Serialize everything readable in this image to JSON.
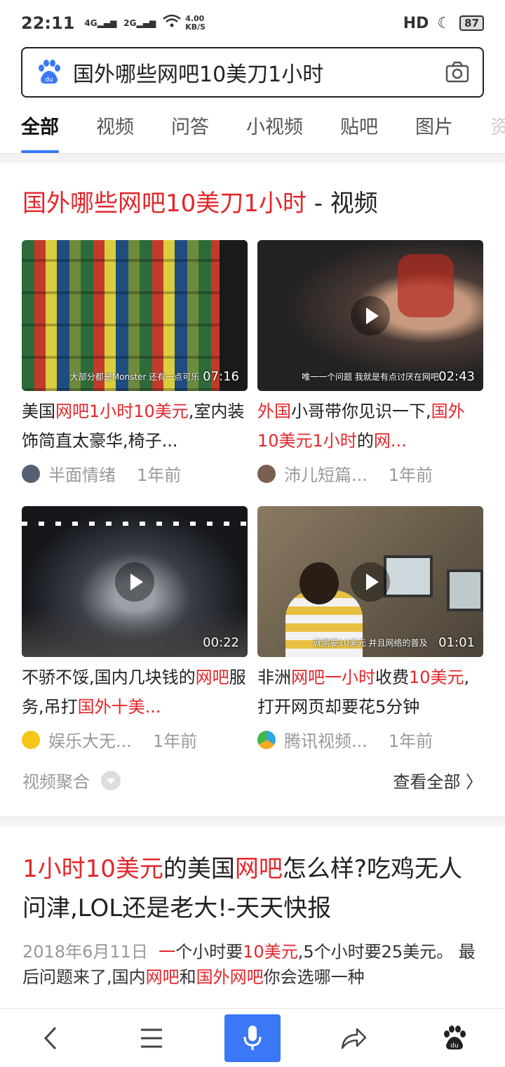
{
  "status_bar": {
    "time": "22:11",
    "signal_1": "4G",
    "signal_2": "2G",
    "speed_value": "4.00",
    "speed_unit": "KB/S",
    "hd": "HD",
    "battery": "87"
  },
  "search": {
    "query": "国外哪些网吧10美刀1小时"
  },
  "tabs": [
    "全部",
    "视频",
    "问答",
    "小视频",
    "贴吧",
    "图片",
    "资"
  ],
  "video_section": {
    "title_highlight": "国外哪些网吧10美刀1小时",
    "title_suffix": " - 视频",
    "cards": [
      {
        "duration": "07:16",
        "caption": "大部分都是Monster 还有一点可乐",
        "title_parts": [
          [
            "美国",
            false
          ],
          [
            "网吧1小时10美元",
            true
          ],
          [
            ",室内装饰简直太豪华,椅子...",
            false
          ]
        ],
        "author": "半面情绪",
        "time": "1年前"
      },
      {
        "duration": "02:43",
        "caption": "唯一一个问题 我就是有点讨厌在网吧",
        "title_parts": [
          [
            "外国",
            true
          ],
          [
            "小哥带你见识一下,",
            false
          ],
          [
            "国外10美元1小时",
            true
          ],
          [
            "的",
            false
          ],
          [
            "网...",
            true
          ]
        ],
        "author": "沛儿短篇...",
        "time": "1年前"
      },
      {
        "duration": "00:22",
        "caption": "",
        "title_parts": [
          [
            "不骄不馁,国内几块钱的",
            false
          ],
          [
            "网吧",
            true
          ],
          [
            "服务,吊打",
            false
          ],
          [
            "国外十美...",
            true
          ]
        ],
        "author": "娱乐大无...",
        "time": "1年前"
      },
      {
        "duration": "01:01",
        "caption": "就需要10美元 并且网络的普及",
        "title_parts": [
          [
            "非洲",
            false
          ],
          [
            "网吧一小时",
            true
          ],
          [
            "收费",
            false
          ],
          [
            "10美元",
            true
          ],
          [
            ",打开网页却要花5分钟",
            false
          ]
        ],
        "author": "腾讯视频...",
        "time": "1年前"
      }
    ],
    "aggregate_label": "视频聚合",
    "view_all": "查看全部 〉"
  },
  "result": {
    "title_parts": [
      [
        "1小时10美元",
        true
      ],
      [
        "的美国",
        false
      ],
      [
        "网吧",
        true
      ],
      [
        "怎么样?吃鸡无人问津,LOL还是老大!-天天快报",
        false
      ]
    ],
    "date": "2018年6月11日",
    "snippet_parts": [
      [
        "一",
        true
      ],
      [
        "个小时要",
        false
      ],
      [
        "10美元",
        true
      ],
      [
        ",5个小时要25美元。 最后问题来了,国内",
        false
      ],
      [
        "网吧",
        true
      ],
      [
        "和",
        false
      ],
      [
        "国外网吧",
        true
      ],
      [
        "你会选哪一种",
        false
      ]
    ]
  },
  "colors": {
    "highlight": "#e4262b",
    "accent": "#3a78f5"
  },
  "icons": [
    "baidu-paw-icon",
    "camera-icon",
    "back-icon",
    "menu-icon",
    "mic-icon",
    "share-icon",
    "baidu-home-icon"
  ]
}
